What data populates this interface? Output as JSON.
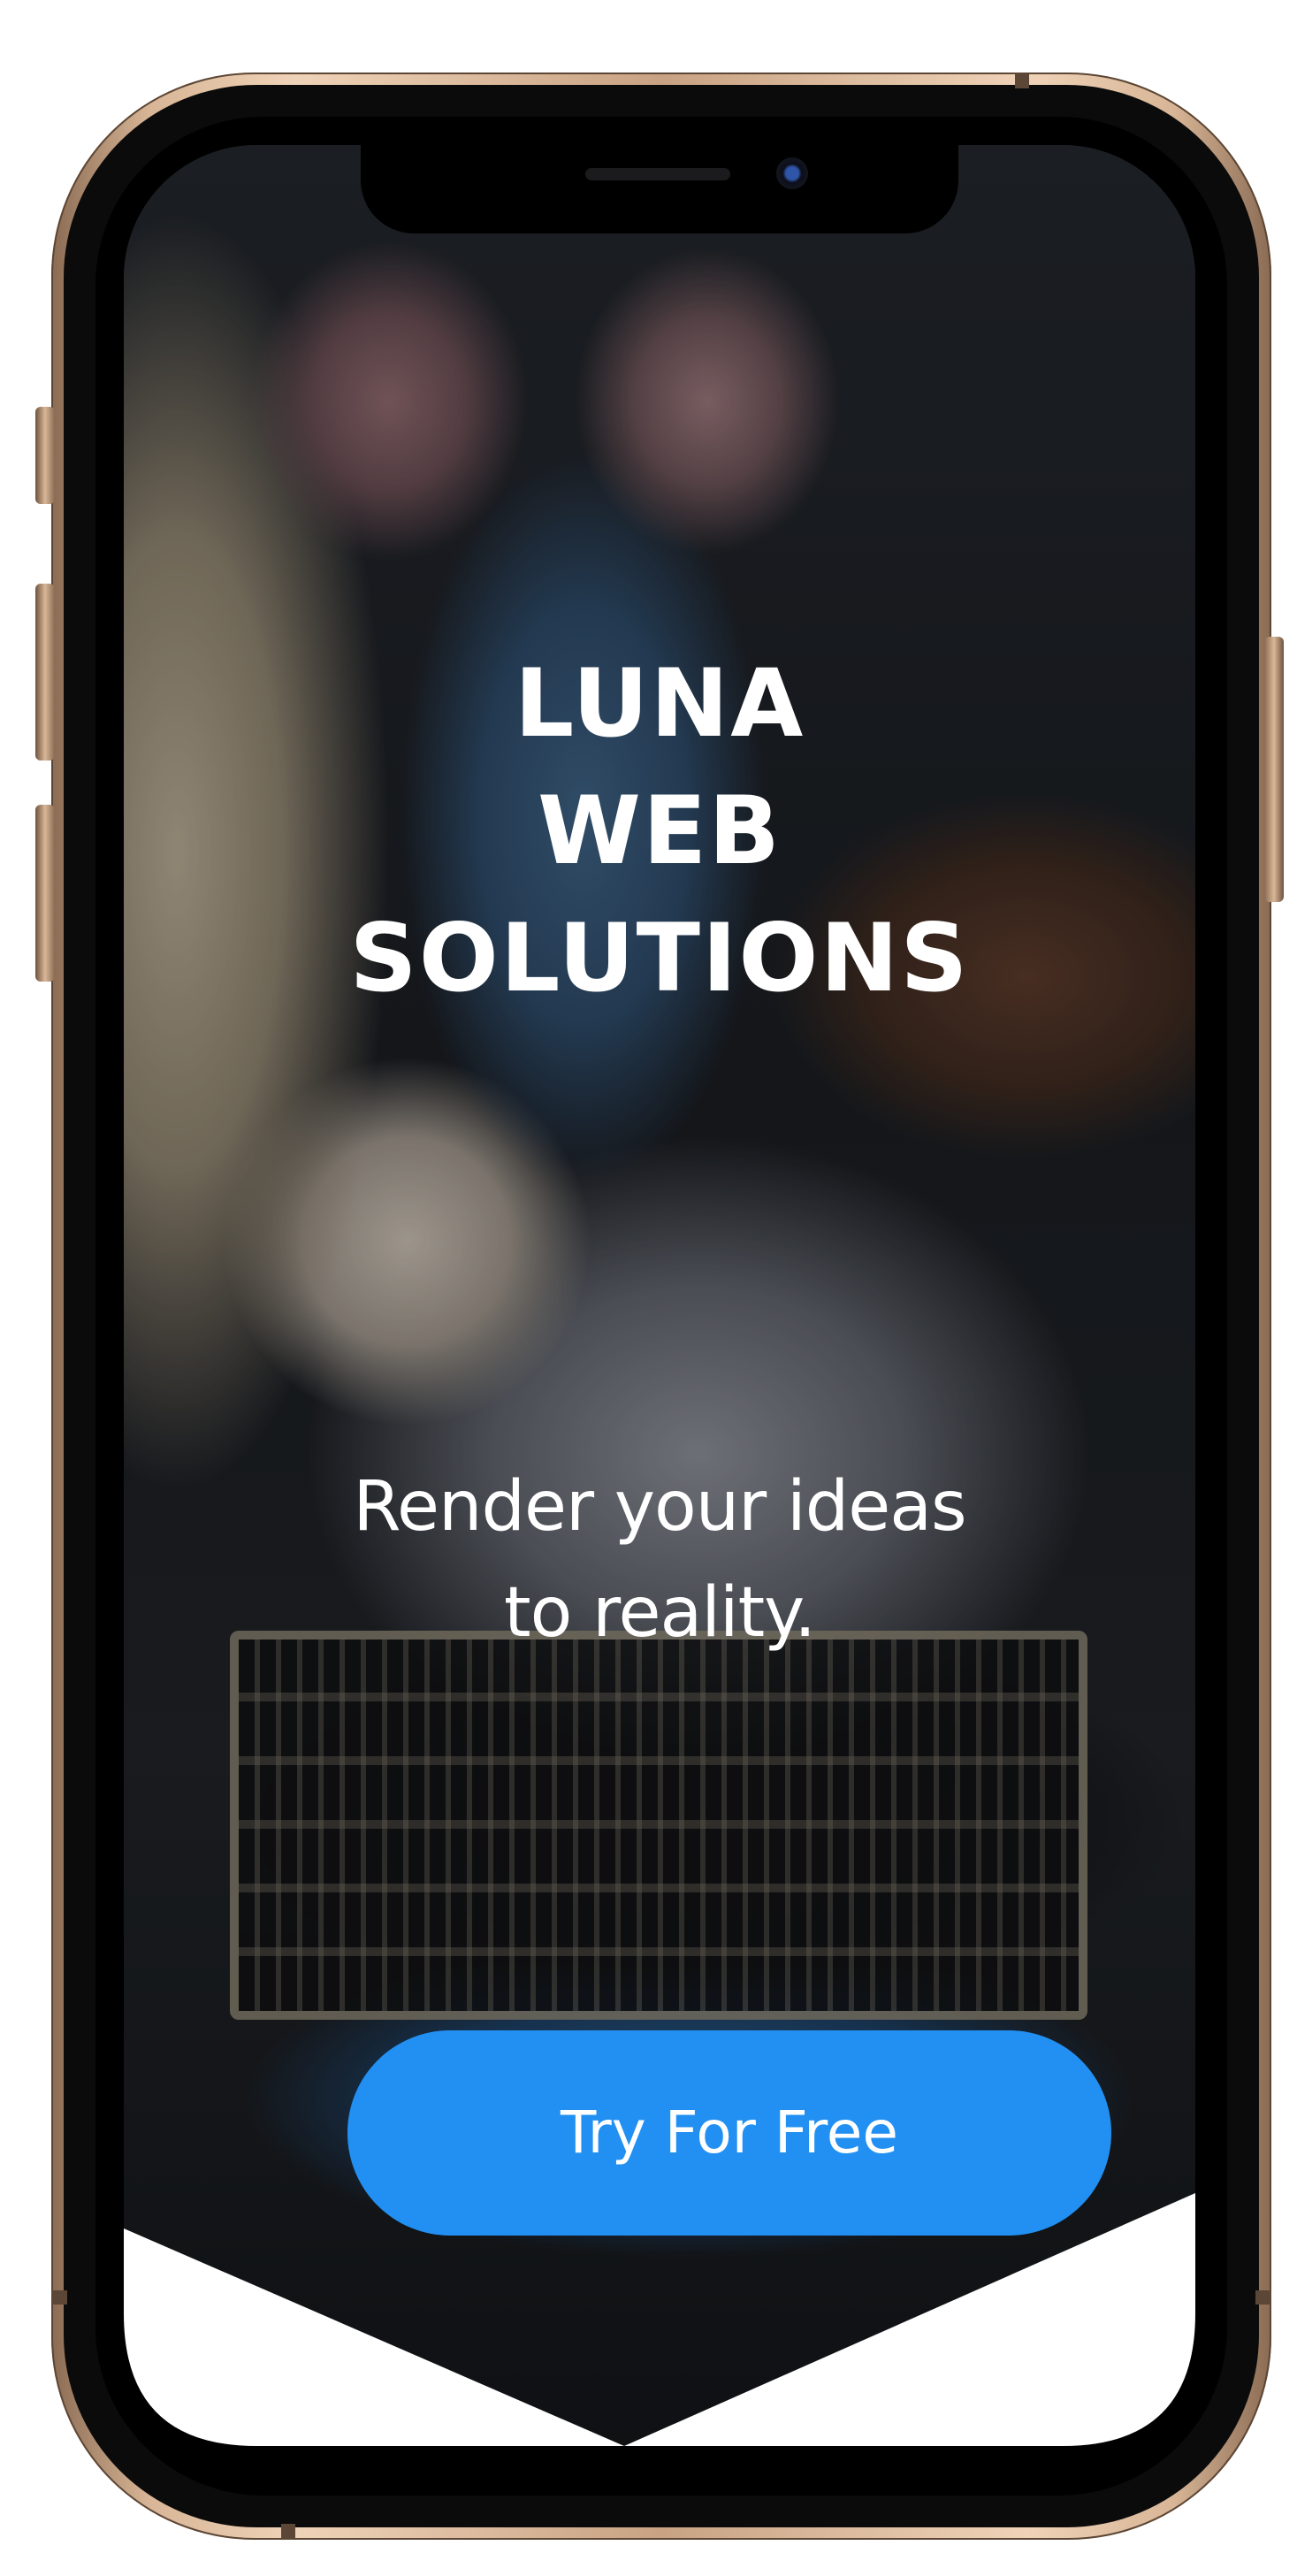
{
  "hero": {
    "title_lines": [
      "LUNA",
      "WEB",
      "SOLUTIONS"
    ],
    "tagline_lines": [
      "Render your ideas",
      "to reality."
    ]
  },
  "cta": {
    "label": "Try For Free"
  },
  "colors": {
    "accent": "#2290f2",
    "text": "#ffffff",
    "device_frame": "#d8b596",
    "chevron": "#ffffff"
  },
  "icons": {
    "scroll_indicator": "chevron-down-icon"
  }
}
